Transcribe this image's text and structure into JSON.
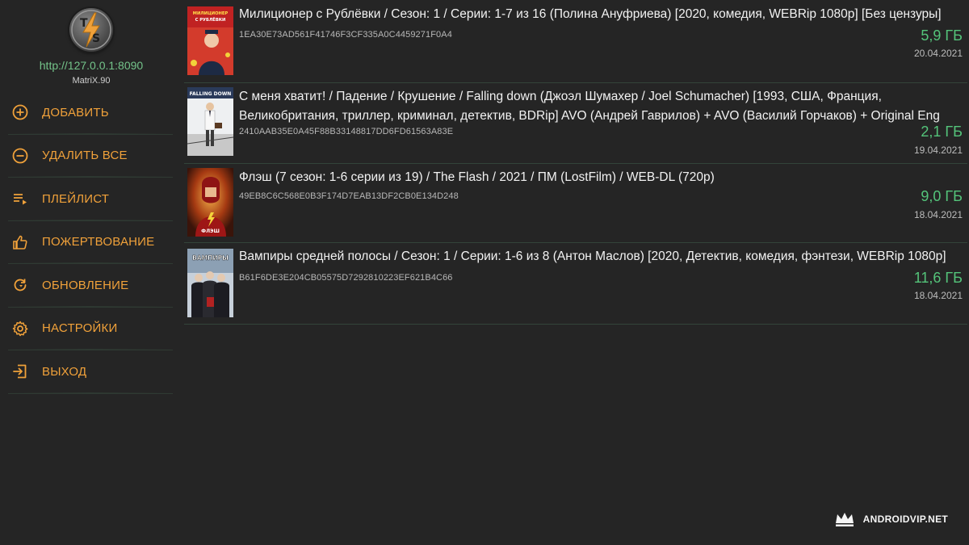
{
  "app": {
    "server_url": "http://127.0.0.1:8090",
    "server_version": "MatriX.90",
    "logo_letters": [
      "T",
      "S"
    ]
  },
  "sidebar": {
    "items": [
      {
        "label": "ДОБАВИТЬ",
        "icon": "add-circle-icon"
      },
      {
        "label": "УДАЛИТЬ ВСЕ",
        "icon": "remove-circle-icon"
      },
      {
        "label": "ПЛЕЙЛИСТ",
        "icon": "playlist-icon"
      },
      {
        "label": "ПОЖЕРТВОВАНИЕ",
        "icon": "thumb-up-icon"
      },
      {
        "label": "ОБНОВЛЕНИЕ",
        "icon": "refresh-icon"
      },
      {
        "label": "НАСТРОЙКИ",
        "icon": "gear-icon"
      },
      {
        "label": "ВЫХОД",
        "icon": "exit-icon"
      }
    ]
  },
  "torrents": [
    {
      "title": "Милиционер с Рублёвки / Сезон: 1 / Серии: 1-7 из 16 (Полина Ануфриева) [2020, комедия, WEBRip 1080p] [Без цензуры]",
      "hash": "1EA30E73AD561F41746F3CF335A0C4459271F0A4",
      "size": "5,9 ГБ",
      "date": "20.04.2021",
      "poster_text": "МИЛИЦИОНЕР С РУБЛЁВКИ"
    },
    {
      "title": "С меня хватит! / Падение / Крушение / Falling down (Джоэл Шумахер / Joel Schumacher) [1993, США, Франция, Великобритания, триллер, криминал, детектив, BDRip] AVO (Андрей Гаврилов) + AVO (Василий Горчаков) + Original Eng",
      "hash": "2410AAB35E0A45F88B33148817DD6FD61563A83E",
      "size": "2,1 ГБ",
      "date": "19.04.2021",
      "poster_text": "FALLING DOWN"
    },
    {
      "title": "Флэш (7 сезон: 1-6 серии из 19) / The Flash / 2021 / ПМ (LostFilm) / WEB-DL (720p)",
      "hash": "49EB8C6C568E0B3F174D7EAB13DF2CB0E134D248",
      "size": "9,0 ГБ",
      "date": "18.04.2021",
      "poster_text": "ФЛЭШ"
    },
    {
      "title": "Вампиры средней полосы / Сезон: 1 / Серии: 1-6 из 8 (Антон Маслов) [2020, Детектив, комедия, фэнтези, WEBRip 1080p]",
      "hash": "B61F6DE3E204CB05575D7292810223EF621B4C66",
      "size": "11,6 ГБ",
      "date": "18.04.2021",
      "poster_text": "ВАМПИРЫ"
    }
  ],
  "watermark": "ANDROIDVIP.NET",
  "colors": {
    "accent_orange": "#f0a13a",
    "size_green": "#54c47a",
    "url_green": "#74c48a",
    "background": "#252525"
  }
}
